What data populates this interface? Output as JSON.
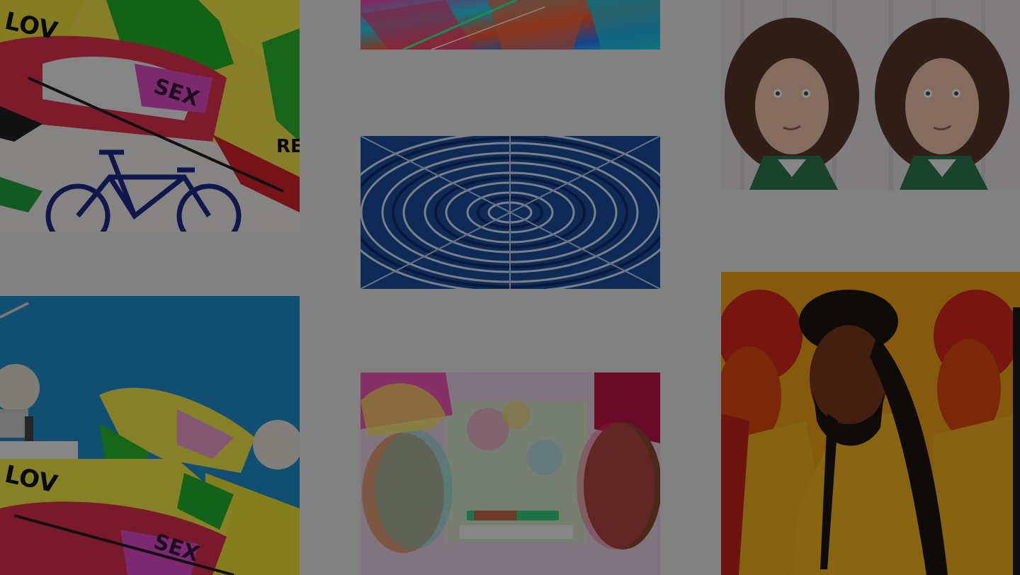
{
  "gallery": {
    "tiles": [
      {
        "name": "tile-love-sign-bike",
        "sign_words": [
          "LOV",
          "SEX",
          "RE"
        ]
      },
      {
        "name": "tile-glitch-portrait-top"
      },
      {
        "name": "tile-double-portrait-woman"
      },
      {
        "name": "tile-blue-kaleidoscope"
      },
      {
        "name": "tile-love-sign-sky",
        "sign_words": [
          "LOV",
          "SEX"
        ]
      },
      {
        "name": "tile-glitch-two-women"
      },
      {
        "name": "tile-yellow-triple-portrait"
      }
    ]
  },
  "overlay": {
    "color": "#000000",
    "opacity": 0.45
  },
  "colors": {
    "background": "#ececec",
    "sky_blue": "#1e8fcf",
    "kaleido_blue": "#1a4f9e",
    "warm_yellow": "#f2a516",
    "red_orange": "#d8281a"
  }
}
